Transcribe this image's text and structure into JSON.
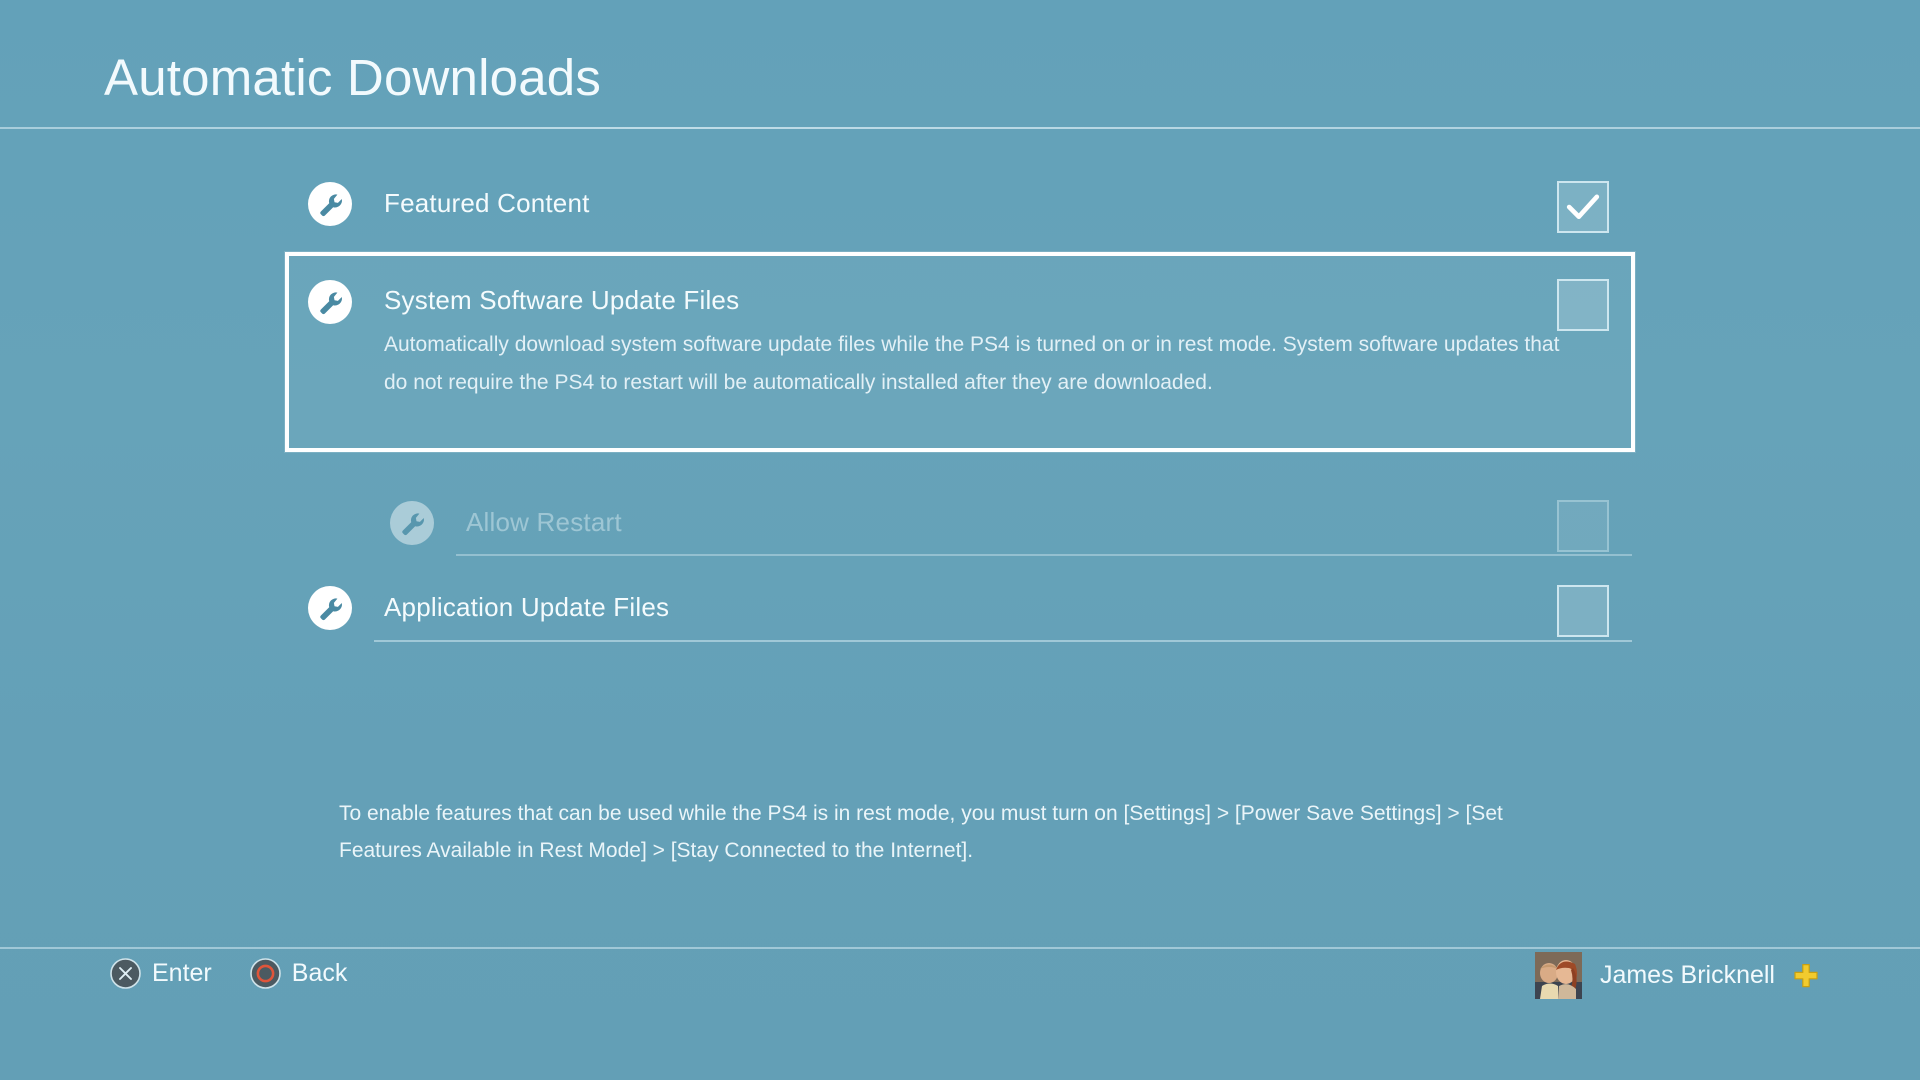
{
  "header": {
    "title": "Automatic Downloads"
  },
  "settings": {
    "items": [
      {
        "id": "featured-content",
        "icon": "wrench-icon",
        "label": "Featured Content",
        "description": "",
        "checked": true,
        "disabled": false,
        "selected": false
      },
      {
        "id": "system-software-update-files",
        "icon": "wrench-icon",
        "label": "System Software Update Files",
        "description": "Automatically download system software update files while the PS4 is turned on or in rest mode. System software updates that do not require the PS4 to restart will be automatically installed after they are downloaded.",
        "checked": false,
        "disabled": false,
        "selected": true
      },
      {
        "id": "allow-restart",
        "icon": "wrench-icon",
        "label": "Allow Restart",
        "description": "",
        "checked": false,
        "disabled": true,
        "selected": false
      },
      {
        "id": "application-update-files",
        "icon": "wrench-icon",
        "label": "Application Update Files",
        "description": "",
        "checked": false,
        "disabled": false,
        "selected": false
      }
    ]
  },
  "help": {
    "text": "To enable features that can be used while the PS4 is in rest mode, you must turn on [Settings] > [Power Save Settings] > [Set Features Available in Rest Mode] > [Stay Connected to the Internet]."
  },
  "bottom_bar": {
    "hints": [
      {
        "id": "enter",
        "glyph": "cross-button-icon",
        "label": "Enter"
      },
      {
        "id": "back",
        "glyph": "circle-button-icon",
        "label": "Back"
      }
    ],
    "user": {
      "name": "James Bricknell",
      "avatar": "user-avatar",
      "badge": "ps-plus-badge-icon"
    }
  },
  "colors": {
    "background": "#64a0b7",
    "text": "#f2fafd",
    "selection_border": "#ffffff",
    "checkbox_border": "#cde6ef",
    "back_button": "#e0553a",
    "plus_badge": "#f2cb2e"
  }
}
